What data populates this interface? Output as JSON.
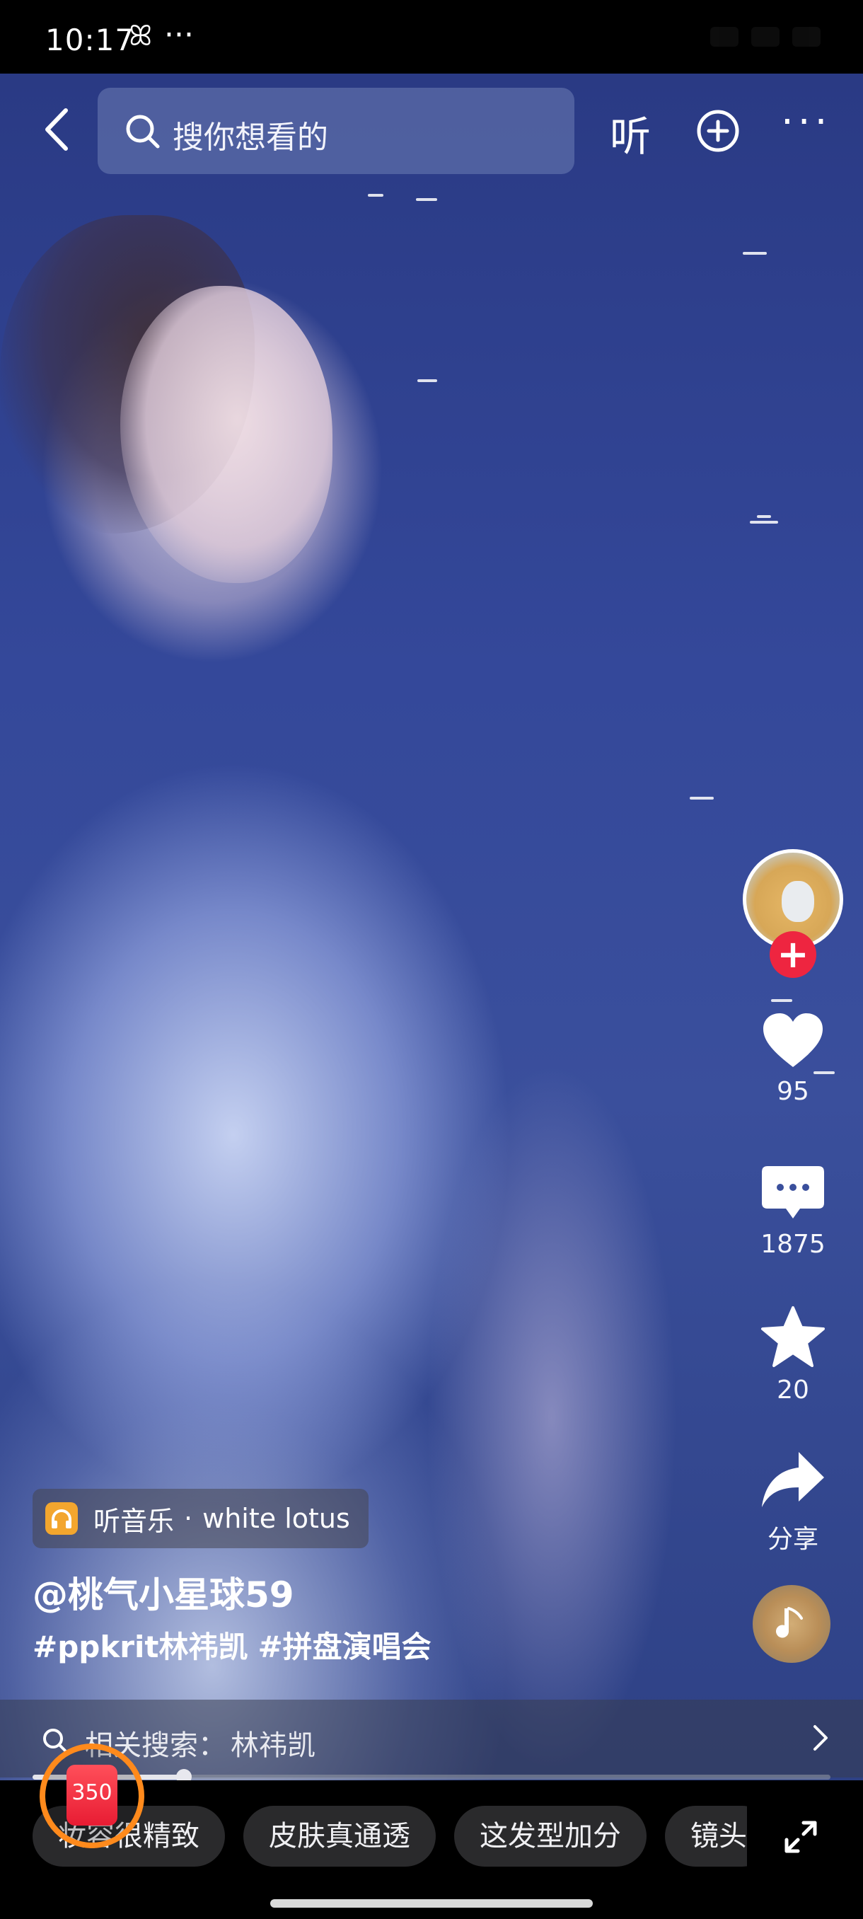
{
  "status_bar": {
    "time": "10:17",
    "extra_icon": "ꕤ",
    "dots": "···"
  },
  "top_bar": {
    "search_placeholder": "搜你想看的",
    "listen_label": "听",
    "more_label": "···"
  },
  "sidebar": {
    "likes": "95",
    "comments": "1875",
    "favorites": "20",
    "share_label": "分享"
  },
  "caption": {
    "music_prefix": "听音乐",
    "music_sep": "·",
    "music_title": "white lotus",
    "author": "@桃气小星球59",
    "hashtags": [
      "#ppkrit林祎凯",
      "#拼盘演唱会"
    ]
  },
  "related_search": {
    "label": "相关搜索：",
    "value": "林祎凯"
  },
  "progress": {
    "fraction": 0.19
  },
  "chips": [
    "妆容很精致",
    "皮肤真通透",
    "这发型加分",
    "镜头"
  ],
  "red_packet": {
    "count": "350"
  },
  "colors": {
    "accent_red": "#ee2540",
    "music_orange": "#f3a62e",
    "redpack_ring": "#ff8a1c"
  }
}
